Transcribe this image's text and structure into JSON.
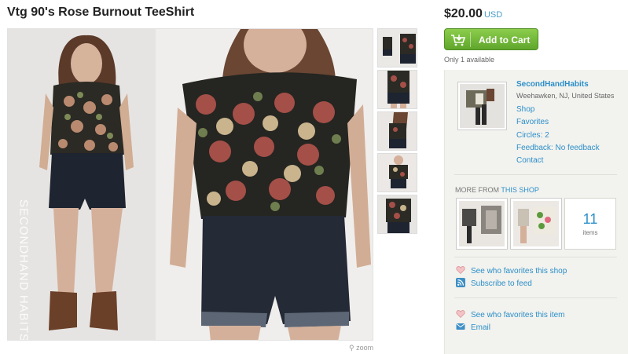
{
  "listing": {
    "title": "Vtg 90's Rose Burnout TeeShirt",
    "watermark": "SECONDHAND HABITS",
    "zoom_label": "zoom"
  },
  "purchase": {
    "price": "$20.00",
    "currency": "USD",
    "add_to_cart_label": "Add to Cart",
    "availability": "Only 1 available",
    "button_color": "#6db636"
  },
  "shop": {
    "name": "SecondHandHabits",
    "location": "Weehawken, NJ, United States",
    "links": [
      "Shop",
      "Favorites",
      "Circles: 2",
      "Feedback: No feedback",
      "Contact"
    ],
    "more_from_prefix": "MORE FROM",
    "more_from_link": "THIS SHOP",
    "item_count": "11",
    "item_count_label": "items"
  },
  "actions": {
    "shop_favorites": "See who favorites this shop",
    "subscribe": "Subscribe to feed",
    "item_favorites": "See who favorites this item",
    "email": "Email"
  },
  "colors": {
    "link": "#2b8fc9",
    "panel_bg": "#f2f2ee"
  }
}
